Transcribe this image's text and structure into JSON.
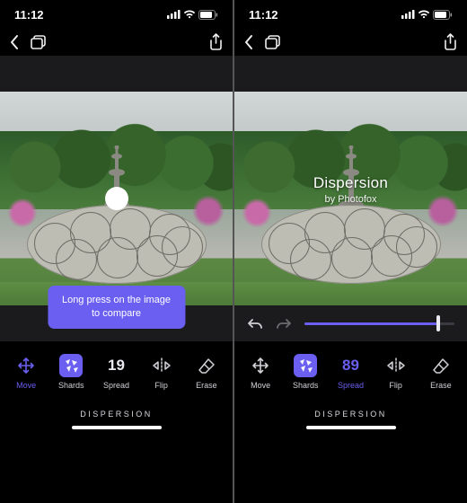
{
  "status": {
    "time": "11:12"
  },
  "left": {
    "tooltip_line1": "Long press on the image",
    "tooltip_line2": "to compare",
    "tools": {
      "move": "Move",
      "shards": "Shards",
      "spread_value": "19",
      "spread": "Spread",
      "flip": "Flip",
      "erase": "Erase"
    }
  },
  "right": {
    "overlay_title": "Dispersion",
    "overlay_sub": "by Photofox",
    "slider_value": 89,
    "tools": {
      "move": "Move",
      "shards": "Shards",
      "spread_value": "89",
      "spread": "Spread",
      "flip": "Flip",
      "erase": "Erase"
    }
  },
  "footer_label": "DISPERSION",
  "colors": {
    "accent": "#6a5ff0"
  }
}
